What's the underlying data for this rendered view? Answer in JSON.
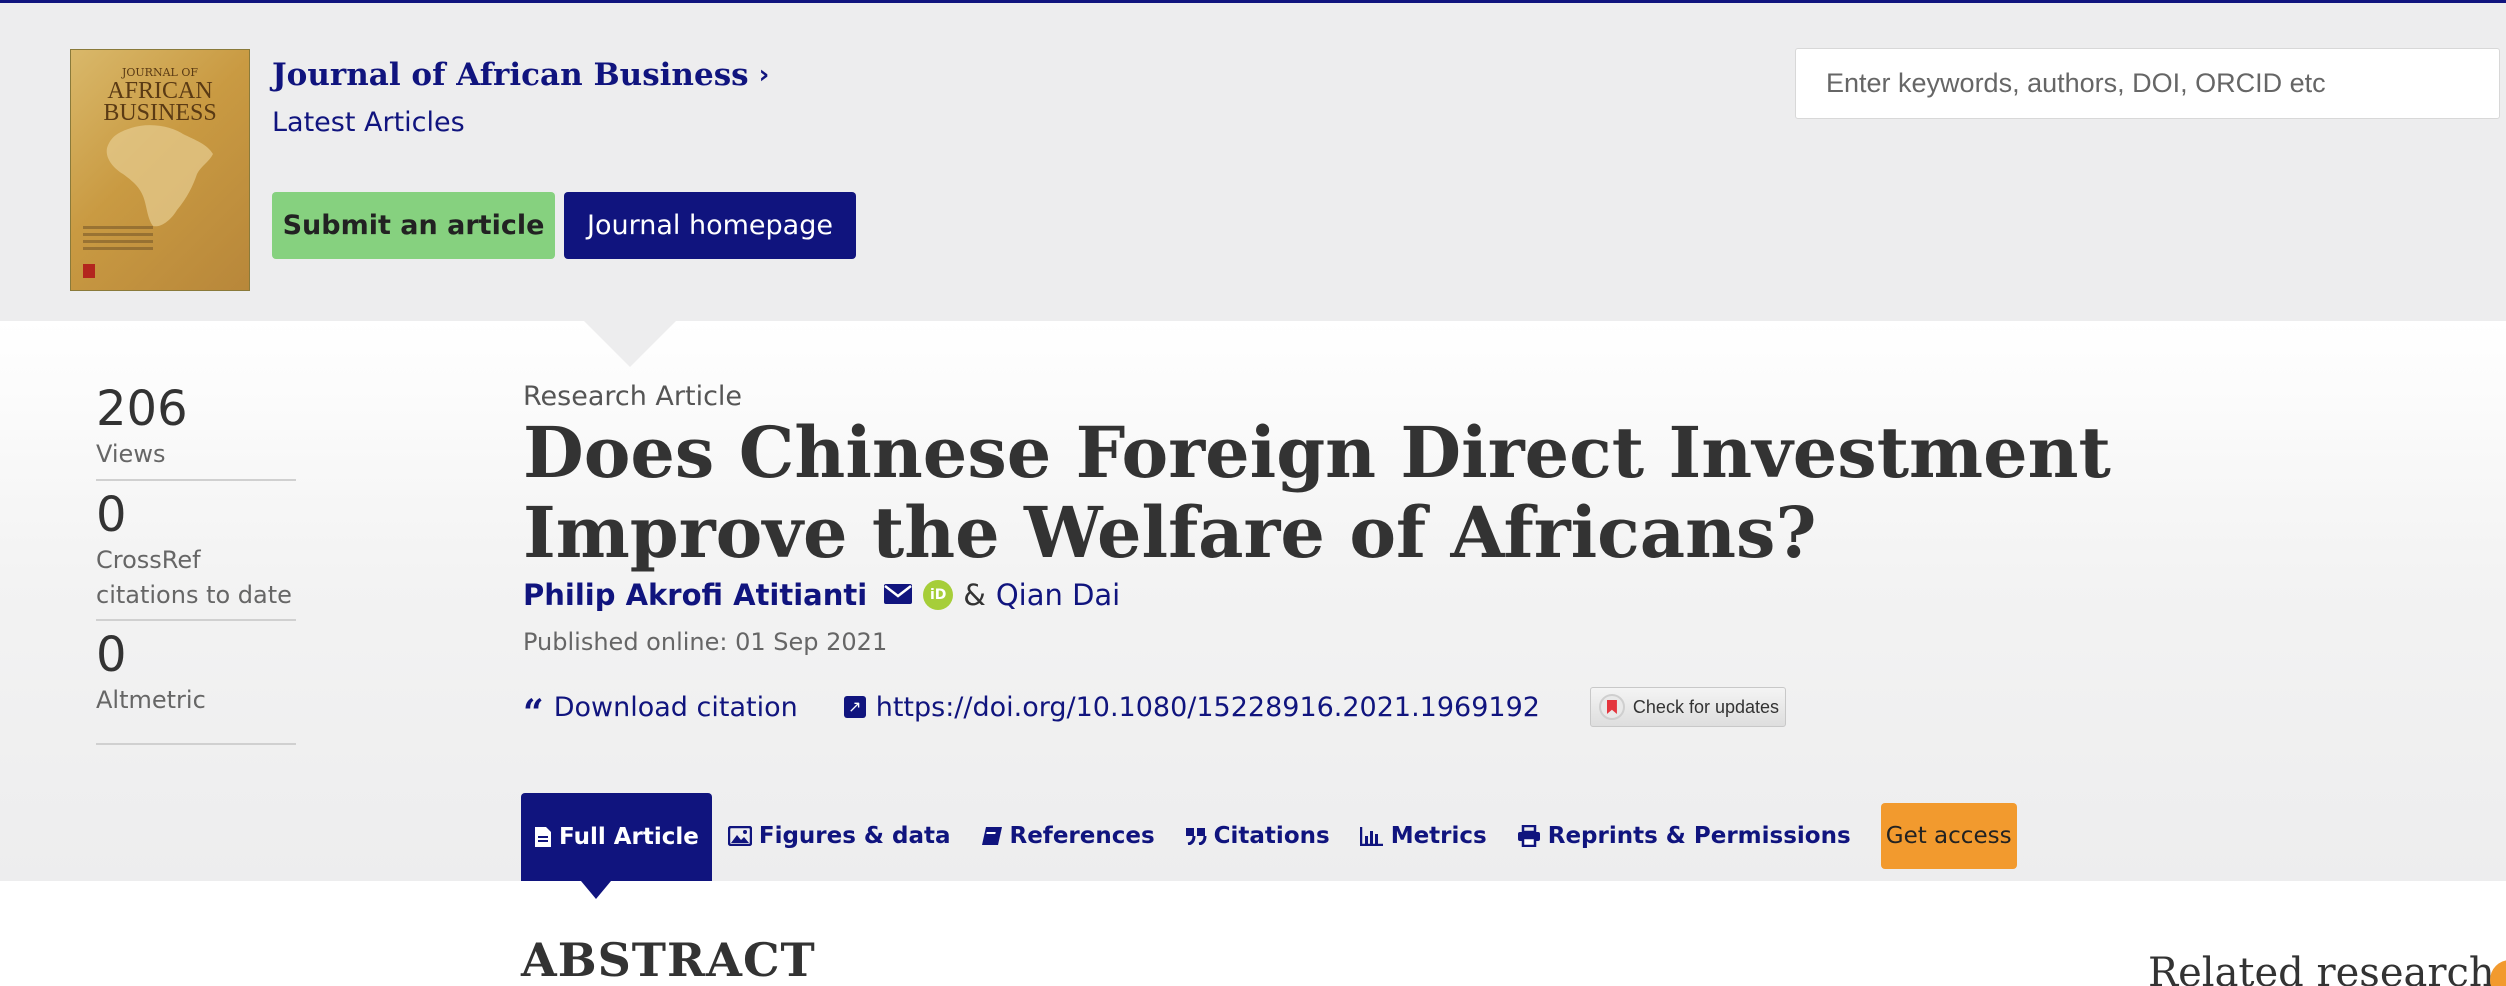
{
  "journal": {
    "title": "Journal of African Business",
    "subtitle": "Latest Articles",
    "submit_label": "Submit an article",
    "homepage_label": "Journal homepage",
    "cover": {
      "title_line1": "JOURNAL OF",
      "title_line2": "AFRICAN",
      "title_line3": "BUSINESS"
    }
  },
  "search": {
    "placeholder": "Enter keywords, authors, DOI, ORCID etc"
  },
  "metrics": [
    {
      "value": "206",
      "label": "Views"
    },
    {
      "value": "0",
      "label": "CrossRef citations to date"
    },
    {
      "value": "0",
      "label": "Altmetric"
    }
  ],
  "article": {
    "type": "Research Article",
    "title": "Does Chinese Foreign Direct Investment Improve the Welfare of Africans?",
    "author1": "Philip Akrofi Atitianti",
    "amp": "&",
    "author2": "Qian Dai",
    "published": "Published online: 01 Sep 2021",
    "download_citation": "Download citation",
    "doi": "https://doi.org/10.1080/15228916.2021.1969192",
    "check_updates": "Check for updates"
  },
  "tabs": [
    {
      "label": "Full Article",
      "icon": "document-icon",
      "active": true
    },
    {
      "label": "Figures & data",
      "icon": "image-icon"
    },
    {
      "label": "References",
      "icon": "book-icon"
    },
    {
      "label": "Citations",
      "icon": "quote-icon"
    },
    {
      "label": "Metrics",
      "icon": "bar-chart-icon"
    },
    {
      "label": "Reprints & Permissions",
      "icon": "printer-icon"
    }
  ],
  "get_access": "Get access",
  "abstract_heading": "ABSTRACT",
  "related_heading": "Related research",
  "colors": {
    "brand_navy": "#10147e",
    "submit_green": "#86d17f",
    "access_orange": "#f29a2e",
    "header_bg": "#ededee"
  }
}
